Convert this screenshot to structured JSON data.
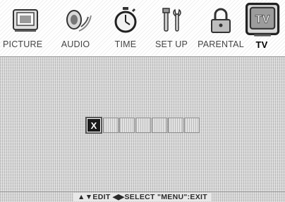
{
  "menu": {
    "tabs": [
      {
        "label": "PICTURE",
        "icon": "picture-icon"
      },
      {
        "label": "AUDIO",
        "icon": "speaker-icon"
      },
      {
        "label": "TIME",
        "icon": "stopwatch-icon"
      },
      {
        "label": "SET UP",
        "icon": "tools-icon"
      },
      {
        "label": "PARENTAL",
        "icon": "lock-icon"
      },
      {
        "label": "TV",
        "icon": "tv-icon"
      }
    ],
    "active_tab": "TV"
  },
  "channel_label_entry": {
    "slots": [
      "X",
      "",
      "",
      "",
      "",
      "",
      ""
    ],
    "active_index": 0
  },
  "help_text": "▲▼EDIT  ◀▶SELECT  \"MENU\":EXIT",
  "colors": {
    "active_slot_bg": "#1a1a1a",
    "label_active": "#000000",
    "label_inactive": "#444444"
  }
}
